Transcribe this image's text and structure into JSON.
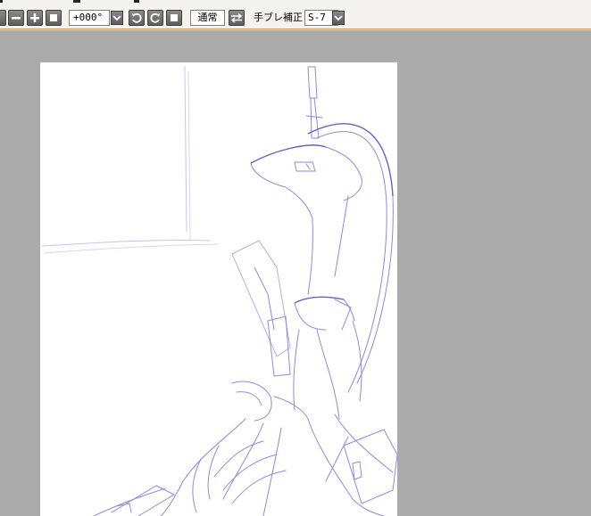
{
  "toolbar": {
    "zoom_value": "+000°",
    "blend_mode_label": "通常",
    "stabilizer_label": "手ブレ補正",
    "stabilizer_value": "S-7"
  },
  "icons": {
    "zoom_out": "minus-icon",
    "zoom_in": "plus-icon",
    "fit": "square-icon",
    "dropdown": "chevron-down-icon",
    "rotate_left": "rotate-left-icon",
    "rotate_right": "rotate-right-icon",
    "reset_rotation": "square-icon",
    "flip": "flip-horizontal-icon"
  },
  "colors": {
    "workspace": "#ababab",
    "toolbar": "#f4f3ef",
    "sketch": "#6f6fd8",
    "paper": "#ffffff"
  }
}
